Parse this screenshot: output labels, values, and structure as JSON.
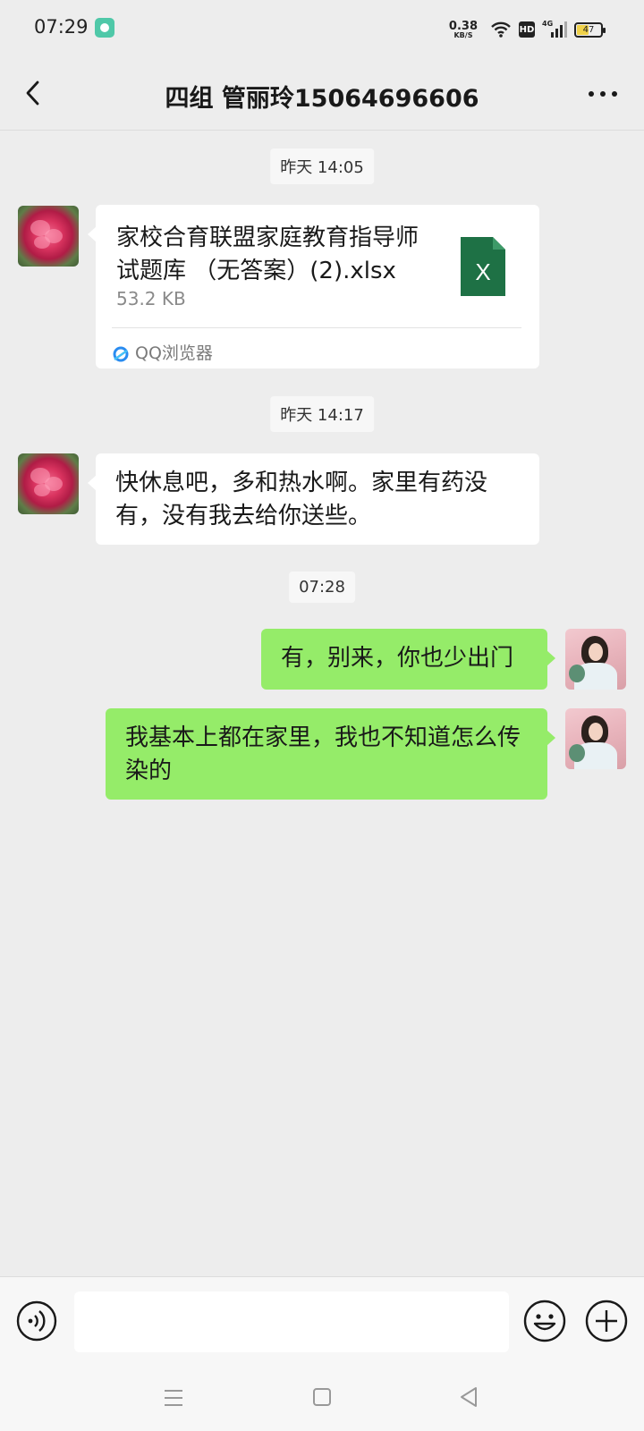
{
  "status_bar": {
    "time": "07:29",
    "net_speed_value": "0.38",
    "net_speed_unit": "KB/S",
    "hd_label": "HD",
    "network_label": "4G",
    "battery_level": "47"
  },
  "header": {
    "title": "四组   管丽玲15064696606"
  },
  "messages": [
    {
      "timestamp": "昨天 14:05"
    },
    {
      "file_name": "家校合育联盟家庭教育指导师试题库 （无答案）(2).xlsx",
      "file_size": "53.2 KB",
      "file_icon_letter": "X",
      "file_source": "QQ浏览器"
    },
    {
      "timestamp": "昨天 14:17"
    },
    {
      "text": "快休息吧，多和热水啊。家里有药没有，没有我去给你送些。"
    },
    {
      "timestamp": "07:28"
    },
    {
      "text": "有，别来，你也少出门"
    },
    {
      "text": "我基本上都在家里，我也不知道怎么传染的"
    }
  ],
  "colors": {
    "outgoing_bubble": "#95ec69",
    "incoming_bubble": "#ffffff",
    "background": "#ededed",
    "excel_green": "#1e7145"
  },
  "icons": {
    "back": "chevron-left-icon",
    "more": "more-dots-icon",
    "voice": "voice-icon",
    "emoji": "emoji-icon",
    "plus": "plus-icon"
  }
}
